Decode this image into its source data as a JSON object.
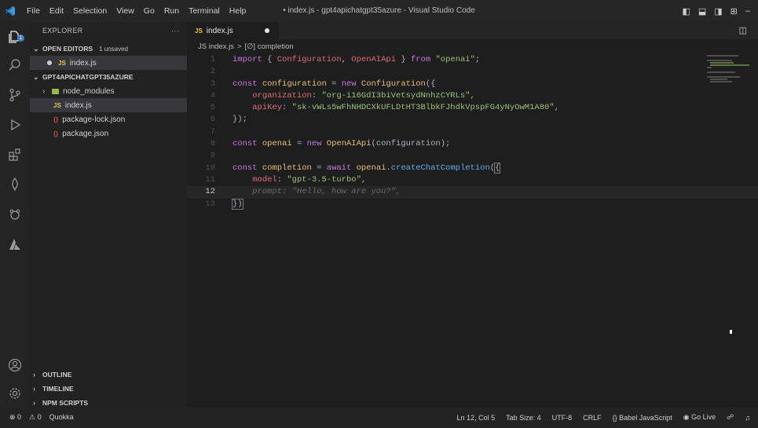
{
  "menu": [
    "File",
    "Edit",
    "Selection",
    "View",
    "Go",
    "Run",
    "Terminal",
    "Help"
  ],
  "window_title": "• index.js - gpt4apichatgpt35azure - Visual Studio Code",
  "explorer": {
    "title": "EXPLORER",
    "more": "···",
    "open_editors": {
      "label": "OPEN EDITORS",
      "badge": "1 unsaved",
      "items": [
        {
          "icon": "JS",
          "name": "index.js"
        }
      ]
    },
    "project": {
      "label": "GPT4APICHATGPT35AZURE",
      "items": [
        {
          "icon": "folder",
          "name": "node_modules"
        },
        {
          "icon": "JS",
          "name": "index.js"
        },
        {
          "icon": "json",
          "name": "package-lock.json"
        },
        {
          "icon": "json",
          "name": "package.json"
        }
      ]
    },
    "bottom_sections": [
      "OUTLINE",
      "TIMELINE",
      "NPM SCRIPTS"
    ]
  },
  "tab": {
    "icon": "JS",
    "label": "index.js"
  },
  "breadcrumb": {
    "file": "JS index.js",
    "sep": ">",
    "symbol": "[∅] completion"
  },
  "code": {
    "line_numbers": [
      "1",
      "2",
      "3",
      "4",
      "5",
      "6",
      "7",
      "8",
      "9",
      "10",
      "11",
      "12",
      "13"
    ],
    "l1": [
      "import",
      "{",
      "Configuration",
      ",",
      "OpenAIApi",
      "}",
      "from",
      "\"openai\"",
      ";"
    ],
    "l3": [
      "const",
      "configuration",
      "=",
      "new",
      "Configuration",
      "({"
    ],
    "l4": [
      "organization",
      ":",
      "\"org-i16GdI3biVetsydNnhzCYRLs\"",
      ","
    ],
    "l5": [
      "apiKey",
      ":",
      "\"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\"",
      ","
    ],
    "l6": "});",
    "l8": [
      "const",
      "openai",
      "=",
      "new",
      "OpenAIApi",
      "(configuration);"
    ],
    "l10": [
      "const",
      "completion",
      "=",
      "await",
      "openai",
      ".",
      "createChatCompletion",
      "(",
      "{"
    ],
    "l11": [
      "model",
      ":",
      "\"gpt-3.5-turbo\"",
      ","
    ],
    "l12": "prompt: \"Hello, how are you?\",",
    "l13": "})"
  },
  "status": {
    "errors": "⊗ 0",
    "warnings": "⚠ 0",
    "quokka": "Quokka",
    "position": "Ln 12, Col 5",
    "tabsize": "Tab Size: 4",
    "encoding": "UTF-8",
    "eol": "CRLF",
    "language": "Babel JavaScript",
    "golive": "Go Live"
  }
}
